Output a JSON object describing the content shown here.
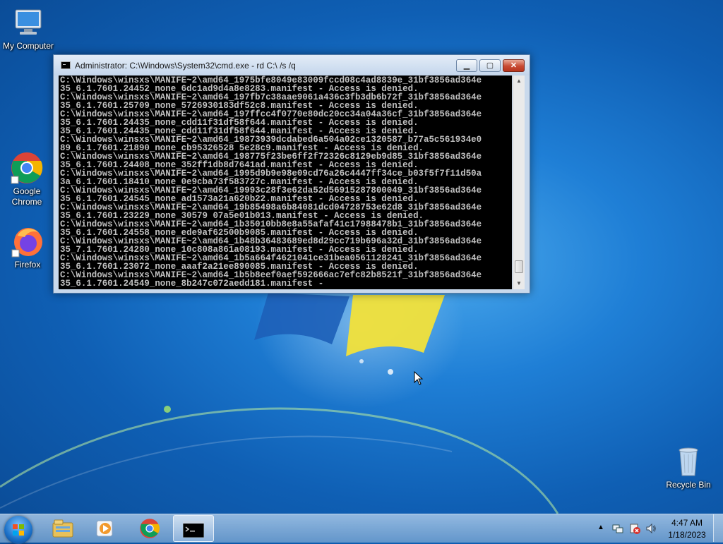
{
  "desktop": {
    "icons": [
      {
        "label": "My Computer"
      },
      {
        "label": "Google Chrome"
      },
      {
        "label": "Firefox"
      },
      {
        "label": "Recycle Bin"
      }
    ]
  },
  "window": {
    "title": "Administrator: C:\\Windows\\System32\\cmd.exe - rd  C:\\ /s /q",
    "minimize_label": "▁",
    "maximize_label": "▢",
    "close_label": "✕",
    "console_text": "C:\\Windows\\winsxs\\MANIFE~2\\amd64_1975bfe8049e83009fccd08c4ad8839e_31bf3856ad364e\n35_6.1.7601.24452_none_6dc1ad9d4a8e8283.manifest - Access is denied.\nC:\\Windows\\winsxs\\MANIFE~2\\amd64_197fb7c38aae9061a436c3fb3db6b72f_31bf3856ad364e\n35_6.1.7601.25709_none_5726930183df52c8.manifest - Access is denied.\nC:\\Windows\\winsxs\\MANIFE~2\\amd64_197ffcc4f0770e80dc20cc34a04a36cf_31bf3856ad364e\n35_6.1.7601.24435_none_cdd11f31df58f644.manifest - Access is denied.\n35_6.1.7601.24435_none_cdd11f31df58f644.manifest - Access is denied.\nC:\\Windows\\winsxs\\MANIFE~2\\amd64_19873939dcdabed6a504a02ce1320587_b77a5c561934e0\n89_6.1.7601.21890_none_cb95326528 5e28c9.manifest - Access is denied.\nC:\\Windows\\winsxs\\MANIFE~2\\amd64_198775f23be6ff2f72326c8129eb9d85_31bf3856ad364e\n35_6.1.7601.24408_none_352ff1db8d7641ad.manifest - Access is denied.\nC:\\Windows\\winsxs\\MANIFE~2\\amd64_1995d9b9e98e09cd76a26c4447ff34ce_b03f5f7f11d50a\n3a_6.1.7601.18410_none_0e9cba73f583727c.manifest - Access is denied.\nC:\\Windows\\winsxs\\MANIFE~2\\amd64_19993c28f3e62da52d56915287800049_31bf3856ad364e\n35_6.1.7601.24545_none_ad1573a21a620b22.manifest - Access is denied.\nC:\\Windows\\winsxs\\MANIFE~2\\amd64_19b85498a6b84081dcd04728753e62d8_31bf3856ad364e\n35_6.1.7601.23229_none_30579 07a5e01b013.manifest - Access is denied.\nC:\\Windows\\winsxs\\MANIFE~2\\amd64_1b35010bb8e8a55afaf41c17988478b1_31bf3856ad364e\n35_6.1.7601.24558_none_ede9af62500b9085.manifest - Access is denied.\nC:\\Windows\\winsxs\\MANIFE~2\\amd64_1b48b36483689ed8d29cc719b696a32d_31bf3856ad364e\n35_7.1.7601.24280_none_10c808a861a08193.manifest - Access is denied.\nC:\\Windows\\winsxs\\MANIFE~2\\amd64_1b5a664f4621041ce31bea0561128241_31bf3856ad364e\n35_6.1.7601.23072_none_aaaf2a21ee890085.manifest - Access is denied.\nC:\\Windows\\winsxs\\MANIFE~2\\amd64_1b5b8eef0aef592666ac7efc82b8521f_31bf3856ad364e\n35_6.1.7601.24549_none_8b247c072aedd181.manifest -"
  },
  "taskbar": {
    "items": [
      {
        "icon": "windows-explorer-icon"
      },
      {
        "icon": "media-player-icon"
      },
      {
        "icon": "chrome-icon"
      },
      {
        "icon": "cmd-icon"
      }
    ]
  },
  "tray": {
    "show_hidden": "▲",
    "time": "4:47 AM",
    "date": "1/18/2023"
  },
  "colors": {
    "desktop_blue": "#1f7fd6",
    "console_bg": "#000000",
    "console_fg": "#c0c0c0"
  }
}
